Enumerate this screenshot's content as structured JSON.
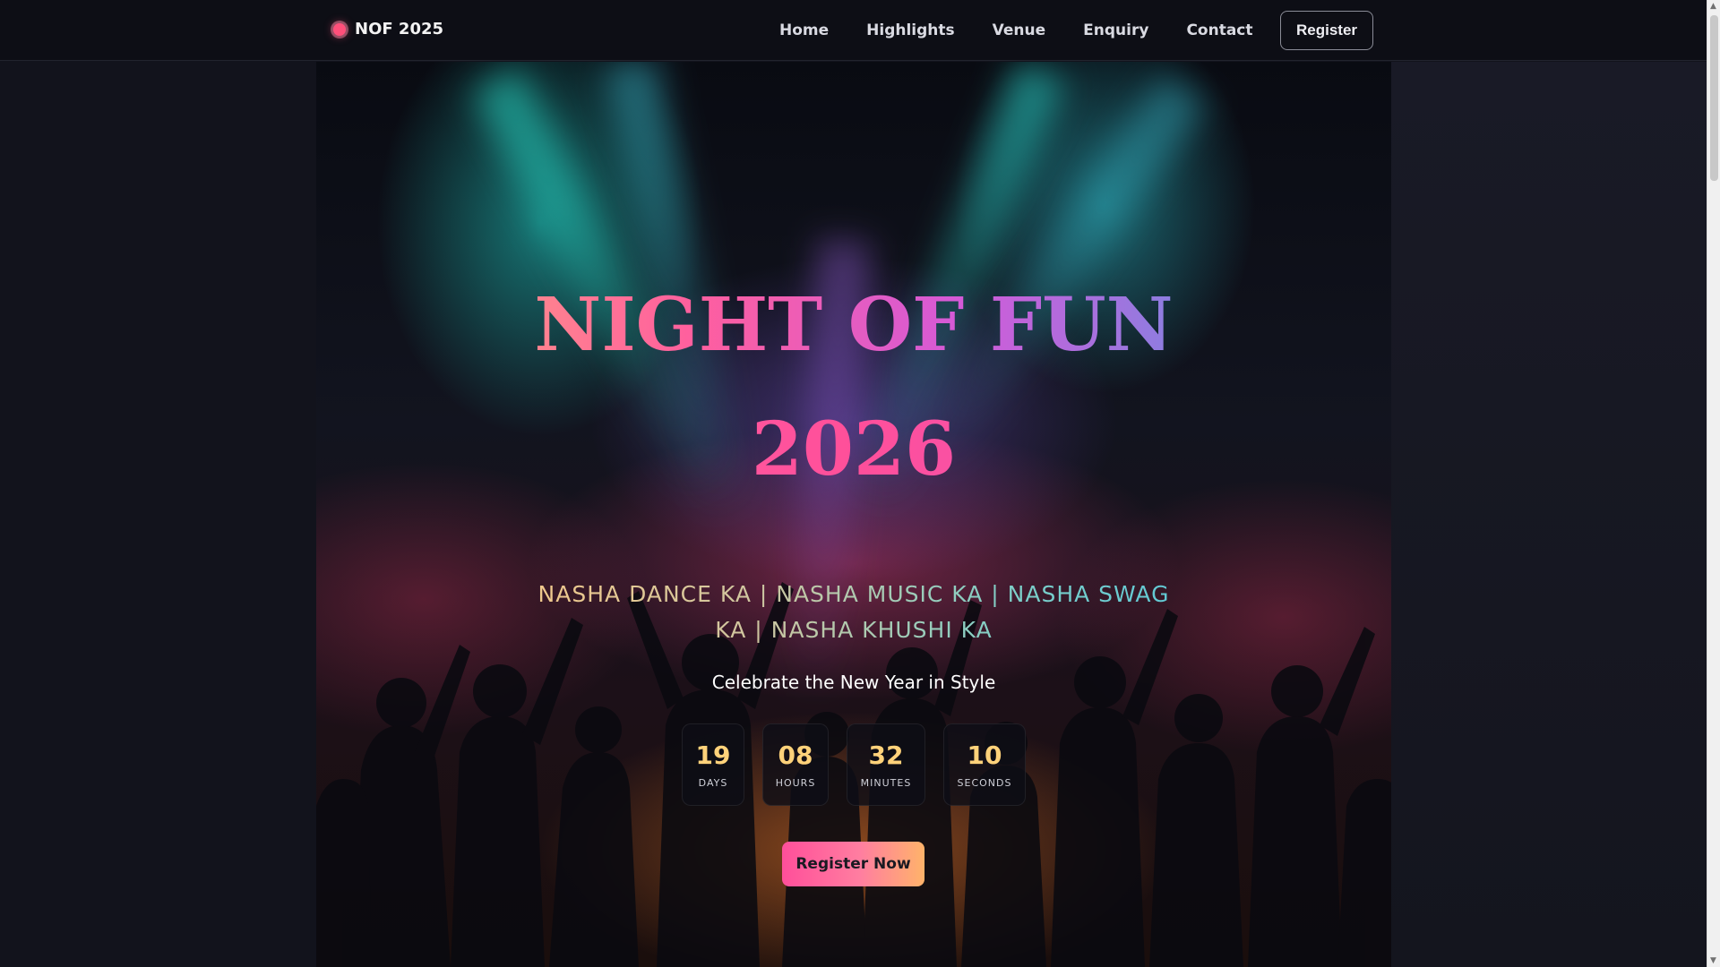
{
  "nav": {
    "brand": "NOF 2025",
    "links": [
      "Home",
      "Highlights",
      "Venue",
      "Enquiry",
      "Contact"
    ],
    "register_label": "Register"
  },
  "hero": {
    "title_line1": "NIGHT OF FUN",
    "title_line2": "2026",
    "tagline": "NASHA DANCE KA | NASHA MUSIC KA | NASHA SWAG KA | NASHA KHUSHI KA",
    "subtitle": "Celebrate the New Year in Style",
    "countdown": [
      {
        "value": "19",
        "label": "DAYS"
      },
      {
        "value": "08",
        "label": "HOURS"
      },
      {
        "value": "32",
        "label": "MINUTES"
      },
      {
        "value": "10",
        "label": "SECONDS"
      }
    ],
    "cta_label": "Register Now"
  },
  "colors": {
    "accent_pink": "#ff4f9a",
    "accent_gold": "#ffd27a",
    "accent_teal": "#5fc9d6",
    "page_bg": "#12131c"
  },
  "icons": {
    "brand": "live-dot-icon"
  }
}
